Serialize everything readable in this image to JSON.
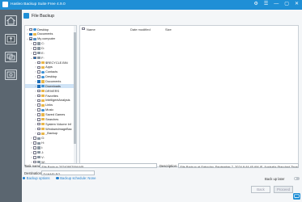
{
  "window": {
    "title": "Hasleo Backup Suite Free 4.9.0",
    "controls": [
      "⚙",
      "☰",
      "—",
      "▢",
      "✕"
    ]
  },
  "sidebar": {
    "items": [
      {
        "name": "home",
        "icon": "house-icon"
      },
      {
        "name": "backup",
        "icon": "backup-icon"
      },
      {
        "name": "restore",
        "icon": "restore-icon"
      },
      {
        "name": "tools",
        "icon": "tools-icon"
      }
    ]
  },
  "header": {
    "title": "File Backup"
  },
  "tree": {
    "rows": [
      {
        "label": "Desktop",
        "indent": 1,
        "icon": "blue",
        "cb": "unchecked",
        "toggle": "›"
      },
      {
        "label": "Documents",
        "indent": 1,
        "icon": "folder",
        "cb": "checked",
        "toggle": "›"
      },
      {
        "label": "My computer",
        "indent": 1,
        "icon": "pc",
        "cb": "partial",
        "toggle": "⌄"
      },
      {
        "label": "C:",
        "indent": 2,
        "icon": "drive",
        "cb": "unchecked",
        "toggle": "›"
      },
      {
        "label": "D:",
        "indent": 2,
        "icon": "drive",
        "cb": "unchecked",
        "toggle": "›"
      },
      {
        "label": "E:",
        "indent": 2,
        "icon": "drive",
        "cb": "unchecked",
        "toggle": "›"
      },
      {
        "label": "F:",
        "indent": 2,
        "icon": "drive",
        "cb": "partial",
        "toggle": "⌄"
      },
      {
        "label": "$RECYCLE.BIN",
        "indent": 3,
        "icon": "folder",
        "cb": "unchecked",
        "toggle": "›"
      },
      {
        "label": "Apps",
        "indent": 3,
        "icon": "folder",
        "cb": "unchecked",
        "toggle": "›"
      },
      {
        "label": "Contacts",
        "indent": 3,
        "icon": "blue",
        "cb": "unchecked",
        "toggle": "›"
      },
      {
        "label": "Desktop",
        "indent": 3,
        "icon": "blue",
        "cb": "unchecked",
        "toggle": "›"
      },
      {
        "label": "Documents",
        "indent": 3,
        "icon": "folder",
        "cb": "checked",
        "toggle": "›"
      },
      {
        "label": "Downloads",
        "indent": 3,
        "icon": "blue",
        "cb": "checked",
        "toggle": "›",
        "selected": true
      },
      {
        "label": "DRIVERS",
        "indent": 3,
        "icon": "folder",
        "cb": "unchecked",
        "toggle": "›"
      },
      {
        "label": "Favorites",
        "indent": 3,
        "icon": "folder",
        "cb": "unchecked",
        "toggle": "›"
      },
      {
        "label": "IntelligentAnalysis",
        "indent": 3,
        "icon": "folder",
        "cb": "unchecked",
        "toggle": "›"
      },
      {
        "label": "Links",
        "indent": 3,
        "icon": "folder",
        "cb": "unchecked",
        "toggle": "›"
      },
      {
        "label": "Music",
        "indent": 3,
        "icon": "blue",
        "cb": "unchecked",
        "toggle": "›"
      },
      {
        "label": "Saved Games",
        "indent": 3,
        "icon": "folder",
        "cb": "unchecked",
        "toggle": "›"
      },
      {
        "label": "Searches",
        "indent": 3,
        "icon": "folder",
        "cb": "unchecked",
        "toggle": "›"
      },
      {
        "label": "System Volume Inf",
        "indent": 3,
        "icon": "folder",
        "cb": "unchecked",
        "toggle": "›"
      },
      {
        "label": "WindowsImageBac",
        "indent": 3,
        "icon": "folder",
        "cb": "unchecked",
        "toggle": "›"
      },
      {
        "label": "_Backup",
        "indent": 3,
        "icon": "folder",
        "cb": "unchecked",
        "toggle": "›"
      },
      {
        "label": "G:",
        "indent": 2,
        "icon": "drive",
        "cb": "unchecked",
        "toggle": "›"
      },
      {
        "label": "H:",
        "indent": 2,
        "icon": "drive",
        "cb": "unchecked",
        "toggle": "›"
      },
      {
        "label": "I:",
        "indent": 2,
        "icon": "drive",
        "cb": "unchecked",
        "toggle": "›"
      },
      {
        "label": "J:",
        "indent": 2,
        "icon": "drive",
        "cb": "unchecked",
        "toggle": "›"
      },
      {
        "label": "V:",
        "indent": 2,
        "icon": "drive",
        "cb": "unchecked",
        "toggle": "›"
      },
      {
        "label": "W:",
        "indent": 2,
        "icon": "drive",
        "cb": "unchecked",
        "toggle": "›"
      }
    ]
  },
  "list": {
    "columns": [
      "Name",
      "Date modified",
      "Size"
    ]
  },
  "task": {
    "name_label": "Task name:",
    "name_value": "File Backup 20240907094445",
    "description_label": "Description:",
    "description_value": "File Backup at Saturday, September 7, 2024 9:44:45 AM IS. Australia Standard Time",
    "destination_label": "Destination:",
    "destination_value": "D:\\HASLEO",
    "backup_later_label": "Back up later"
  },
  "links": {
    "options": "Backup options",
    "schedule": "Backup schedule: None"
  },
  "buttons": {
    "back": "Back",
    "proceed": "Proceed"
  },
  "colors": {
    "accent": "#1f8fd6",
    "sidebar": "#5b6670",
    "selected_row": "#cfe3f6"
  }
}
